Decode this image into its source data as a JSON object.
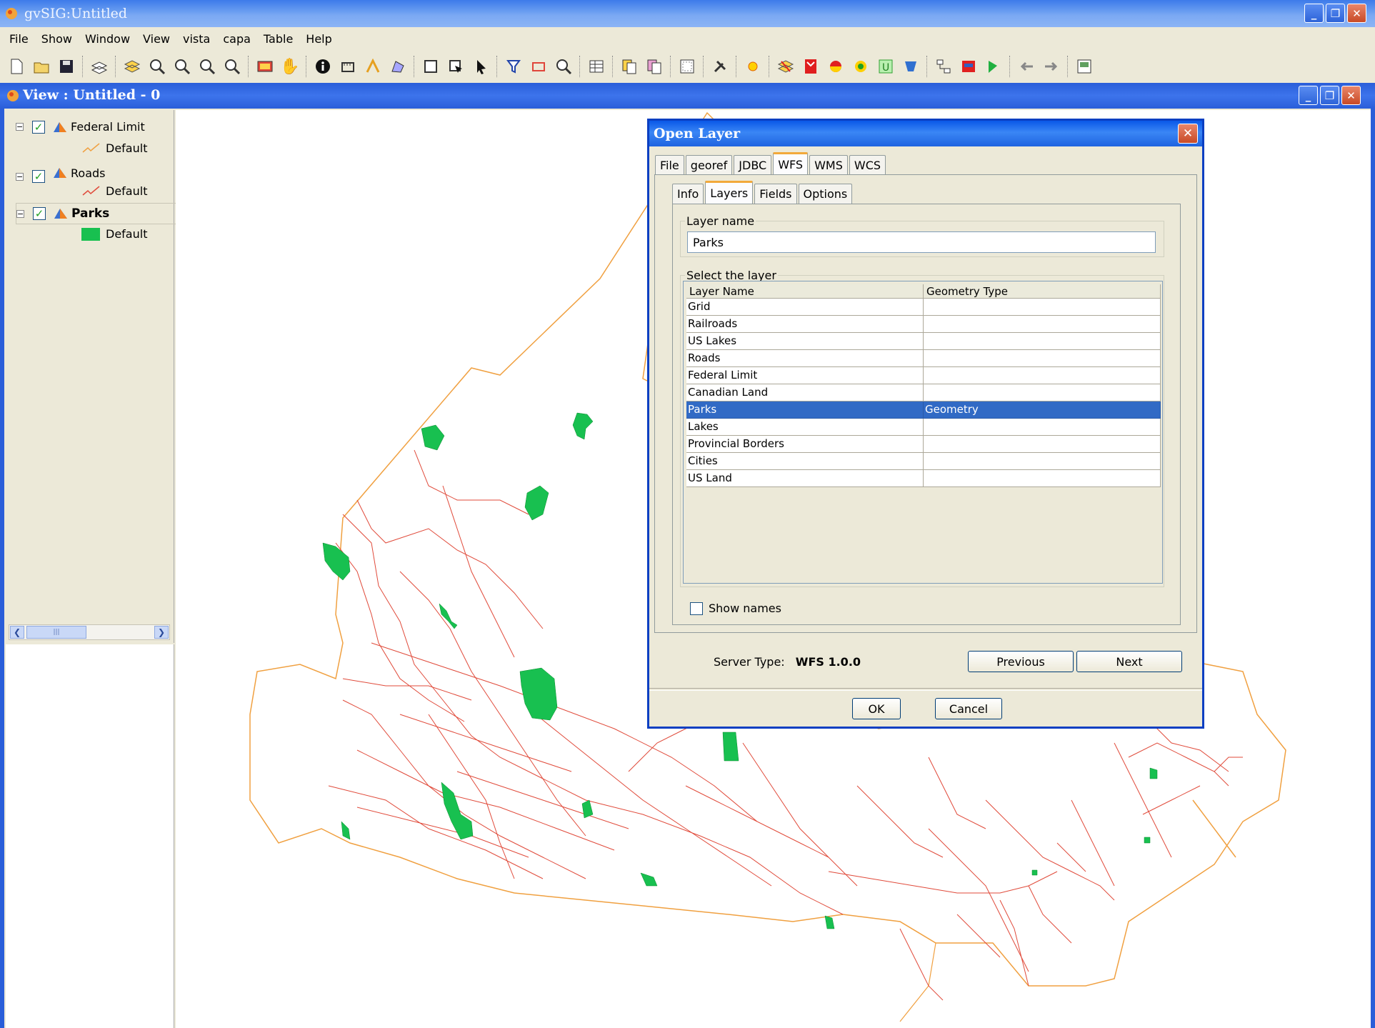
{
  "app": {
    "title": "gvSIG:Untitled"
  },
  "menu": [
    "File",
    "Show",
    "Window",
    "View",
    "vista",
    "capa",
    "Table",
    "Help"
  ],
  "toolbar": {
    "icons": [
      "new-icon",
      "open-icon",
      "save-icon",
      "add-layer-icon",
      "layers-icon",
      "zoom-extent-icon",
      "zoom-previous-icon",
      "zoom-in-icon",
      "zoom-out-icon",
      "select-icon",
      "pan-icon",
      "info-icon",
      "measure-icon",
      "area-icon",
      "rectangle-select-icon",
      "point-select-icon",
      "pointer-icon",
      "filter-icon",
      "polygon-select-icon",
      "zoom-select-icon",
      "table-icon",
      "copy-icon",
      "paste-icon",
      "grid-icon",
      "tools-icon",
      "star-icon",
      "wfs-icon",
      "geoprocess-icon",
      "buffer-icon",
      "dissolve-icon",
      "union-icon",
      "clip-icon",
      "network-icon",
      "raster-icon",
      "flag-icon",
      "back-arrow-icon",
      "forward-arrow-icon",
      "export-icon"
    ]
  },
  "view": {
    "title": "View : Untitled - 0"
  },
  "toc": {
    "layers": [
      {
        "name": "Federal Limit",
        "legend": "Default",
        "bold": false,
        "symbol": "line-orange"
      },
      {
        "name": "Roads",
        "legend": "Default",
        "bold": false,
        "symbol": "line-red"
      },
      {
        "name": "Parks",
        "legend": "Default",
        "bold": true,
        "symbol": "fill-green"
      }
    ],
    "scroll_thumb": "|||"
  },
  "dialog": {
    "title": "Open Layer",
    "close_glyph": "✕",
    "tabs": [
      "File",
      "georef",
      "JDBC",
      "WFS",
      "WMS",
      "WCS"
    ],
    "active_tab": "WFS",
    "subtabs": [
      "Info",
      "Layers",
      "Fields",
      "Options"
    ],
    "active_subtab": "Layers",
    "layer_name_label": "Layer name",
    "layer_name_value": "Parks",
    "select_label": "Select the layer",
    "columns": [
      "Layer Name",
      "Geometry Type"
    ],
    "rows": [
      {
        "name": "Grid",
        "geom": ""
      },
      {
        "name": "Railroads",
        "geom": ""
      },
      {
        "name": "US Lakes",
        "geom": ""
      },
      {
        "name": "Roads",
        "geom": ""
      },
      {
        "name": "Federal Limit",
        "geom": ""
      },
      {
        "name": "Canadian Land",
        "geom": ""
      },
      {
        "name": "Parks",
        "geom": "Geometry"
      },
      {
        "name": "Lakes",
        "geom": ""
      },
      {
        "name": "Provincial Borders",
        "geom": ""
      },
      {
        "name": "Cities",
        "geom": ""
      },
      {
        "name": "US Land",
        "geom": ""
      }
    ],
    "selected_row": "Parks",
    "show_names_label": "Show names",
    "show_names_checked": false,
    "server_type_label": "Server Type:",
    "server_type_value": "WFS 1.0.0",
    "previous_label": "Previous",
    "next_label": "Next",
    "ok_label": "OK",
    "cancel_label": "Cancel"
  },
  "colors": {
    "federal_limit": "#f0a040",
    "roads": "#e04a3a",
    "parks": "#18c050",
    "selection": "#316ac5"
  }
}
